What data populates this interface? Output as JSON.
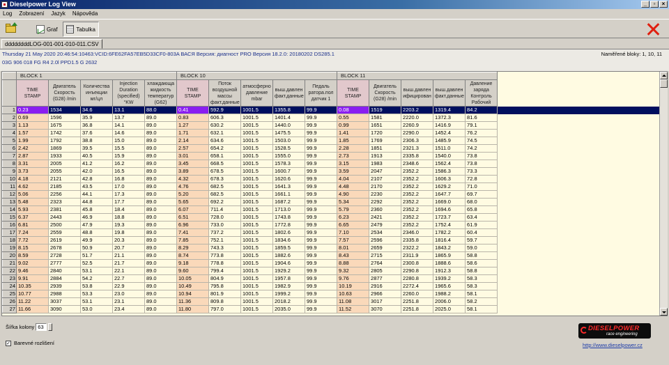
{
  "window": {
    "title": "Dieselpower Log View"
  },
  "menu": [
    "Log",
    "Zobrazení",
    "Jazyk",
    "Nápověda"
  ],
  "toolbar": {
    "graf_label": "Graf",
    "tabulka_label": "Tabulka"
  },
  "file_tab": "ddddddddLOG-001-001-010-011.CSV",
  "info": {
    "line1": "Thursday 21 May 2020 20:46:54:10463:VCID:6FE62FA57EB5D33CF0-803A ВАСЯ Версия: диагност PRO Версия 18.2.0: 20180202 DS285.1",
    "line2": "03G 906 018 FG   R4 2.0l PPD1.5 G    2632",
    "measured_blocks": "Naměřené bloky: 1, 10, 11"
  },
  "blocks": [
    {
      "label": "BLOCK 1",
      "cols": [
        "TIME STAMP",
        "Двигатель Скорость (G28) /min",
        "Количества инъекции мг/цл",
        "Injection Duration (specified) °KW",
        "хлаждающа жидкость температур (G62)"
      ]
    },
    {
      "label": "BLOCK 10",
      "cols": [
        "TIME STAMP",
        "Поток воздушной массы факт.данные",
        "атмосферно давление mbar",
        "выш.давлен факт.данные",
        "Педаль ратора.пол датчик 1"
      ]
    },
    {
      "label": "BLOCK 11",
      "cols": [
        "TIME STAMP",
        "Двигатель Скорость (G28) /min",
        "выш.давлен ифицирован",
        "выш.давлен факт.данные",
        "Давление заряда Контроль Рабочий"
      ]
    }
  ],
  "rows": [
    [
      "0.23",
      "1534",
      "34.6",
      "13.1",
      "88.0",
      "0.41",
      "592.9",
      "1001.5",
      "1355.8",
      "99.9",
      "0.08",
      "1519",
      "2203.2",
      "1319.4",
      "84.2"
    ],
    [
      "0.69",
      "1596",
      "35.9",
      "13.7",
      "89.0",
      "0.83",
      "606.3",
      "1001.5",
      "1401.4",
      "99.9",
      "0.55",
      "1581",
      "2220.0",
      "1372.3",
      "81.6"
    ],
    [
      "1.13",
      "1675",
      "36.8",
      "14.1",
      "89.0",
      "1.27",
      "630.2",
      "1001.5",
      "1440.0",
      "99.9",
      "0.99",
      "1651",
      "2260.9",
      "1416.9",
      "79.1"
    ],
    [
      "1.57",
      "1742",
      "37.6",
      "14.6",
      "89.0",
      "1.71",
      "632.1",
      "1001.5",
      "1475.5",
      "99.9",
      "1.41",
      "1720",
      "2290.0",
      "1452.4",
      "76.2"
    ],
    [
      "1.99",
      "1792",
      "38.8",
      "15.0",
      "89.0",
      "2.14",
      "634.6",
      "1001.5",
      "1503.0",
      "99.9",
      "1.85",
      "1769",
      "2306.3",
      "1485.9",
      "74.5"
    ],
    [
      "2.42",
      "1869",
      "39.5",
      "15.5",
      "89.0",
      "2.57",
      "654.2",
      "1001.5",
      "1528.5",
      "99.9",
      "2.28",
      "1851",
      "2321.3",
      "1511.0",
      "74.2"
    ],
    [
      "2.87",
      "1933",
      "40.5",
      "15.9",
      "89.0",
      "3.01",
      "658.1",
      "1001.5",
      "1555.0",
      "99.9",
      "2.73",
      "1913",
      "2335.8",
      "1540.0",
      "73.8"
    ],
    [
      "3.31",
      "2005",
      "41.2",
      "16.2",
      "89.0",
      "3.45",
      "668.5",
      "1001.5",
      "1578.3",
      "99.9",
      "3.15",
      "1983",
      "2348.6",
      "1562.4",
      "73.8"
    ],
    [
      "3.73",
      "2055",
      "42.0",
      "16.5",
      "89.0",
      "3.89",
      "678.5",
      "1001.5",
      "1600.7",
      "99.9",
      "3.59",
      "2047",
      "2352.2",
      "1586.3",
      "73.3"
    ],
    [
      "4.18",
      "2121",
      "42.8",
      "16.8",
      "89.0",
      "4.32",
      "678.3",
      "1001.5",
      "1620.6",
      "99.9",
      "4.04",
      "2107",
      "2352.2",
      "1606.3",
      "72.8"
    ],
    [
      "4.62",
      "2185",
      "43.5",
      "17.0",
      "89.0",
      "4.76",
      "682.5",
      "1001.5",
      "1641.3",
      "99.9",
      "4.48",
      "2170",
      "2352.2",
      "1629.2",
      "71.0"
    ],
    [
      "5.06",
      "2256",
      "44.1",
      "17.3",
      "89.0",
      "5.20",
      "682.5",
      "1001.5",
      "1661.1",
      "99.9",
      "4.90",
      "2230",
      "2352.2",
      "1647.7",
      "69.7"
    ],
    [
      "5.48",
      "2323",
      "44.8",
      "17.7",
      "89.0",
      "5.65",
      "692.2",
      "1001.5",
      "1687.2",
      "99.9",
      "5.34",
      "2292",
      "2352.2",
      "1669.0",
      "68.0"
    ],
    [
      "5.93",
      "2381",
      "45.8",
      "18.4",
      "89.0",
      "6.07",
      "711.4",
      "1001.5",
      "1713.0",
      "99.9",
      "5.79",
      "2360",
      "2352.2",
      "1694.6",
      "65.8"
    ],
    [
      "6.37",
      "2443",
      "46.9",
      "18.8",
      "89.0",
      "6.51",
      "728.0",
      "1001.5",
      "1743.8",
      "99.9",
      "6.23",
      "2421",
      "2352.2",
      "1723.7",
      "63.4"
    ],
    [
      "6.81",
      "2500",
      "47.9",
      "19.3",
      "89.0",
      "6.96",
      "733.0",
      "1001.5",
      "1772.8",
      "99.9",
      "6.65",
      "2479",
      "2352.2",
      "1752.4",
      "61.9"
    ],
    [
      "7.24",
      "2559",
      "48.8",
      "19.8",
      "89.0",
      "7.41",
      "737.2",
      "1001.5",
      "1802.6",
      "99.9",
      "7.10",
      "2534",
      "2346.0",
      "1782.2",
      "60.4"
    ],
    [
      "7.72",
      "2619",
      "49.9",
      "20.3",
      "89.0",
      "7.85",
      "752.1",
      "1001.5",
      "1834.6",
      "99.9",
      "7.57",
      "2596",
      "2335.8",
      "1816.4",
      "59.7"
    ],
    [
      "8.15",
      "2678",
      "50.9",
      "20.7",
      "89.0",
      "8.29",
      "743.3",
      "1001.5",
      "1859.5",
      "99.9",
      "8.01",
      "2659",
      "2322.2",
      "1843.2",
      "59.0"
    ],
    [
      "8.59",
      "2728",
      "51.7",
      "21.1",
      "89.0",
      "8.74",
      "773.8",
      "1001.5",
      "1882.6",
      "99.9",
      "8.43",
      "2715",
      "2311.9",
      "1865.9",
      "58.8"
    ],
    [
      "9.02",
      "2777",
      "52.5",
      "21.7",
      "89.0",
      "9.18",
      "778.8",
      "1001.5",
      "1904.6",
      "99.9",
      "8.88",
      "2764",
      "2300.8",
      "1888.6",
      "58.6"
    ],
    [
      "9.46",
      "2840",
      "53.1",
      "22.1",
      "89.0",
      "9.60",
      "799.4",
      "1001.5",
      "1929.2",
      "99.9",
      "9.32",
      "2805",
      "2290.8",
      "1912.3",
      "58.8"
    ],
    [
      "9.91",
      "2884",
      "54.2",
      "22.7",
      "89.0",
      "10.05",
      "804.9",
      "1001.5",
      "1957.8",
      "99.9",
      "9.76",
      "2877",
      "2280.8",
      "1939.2",
      "58.3"
    ],
    [
      "10.35",
      "2939",
      "53.8",
      "22.9",
      "89.0",
      "10.49",
      "795.8",
      "1001.5",
      "1982.9",
      "99.9",
      "10.19",
      "2916",
      "2272.4",
      "1965.6",
      "58.3"
    ],
    [
      "10.77",
      "2988",
      "53.3",
      "23.0",
      "89.0",
      "10.94",
      "801.9",
      "1001.5",
      "1999.2",
      "99.9",
      "10.63",
      "2966",
      "2260.0",
      "1988.2",
      "58.1"
    ],
    [
      "11.22",
      "3037",
      "53.1",
      "23.1",
      "89.0",
      "11.36",
      "809.8",
      "1001.5",
      "2018.2",
      "99.9",
      "11.08",
      "3017",
      "2251.8",
      "2006.0",
      "58.2"
    ],
    [
      "11.66",
      "3090",
      "53.0",
      "23.4",
      "89.0",
      "11.80",
      "797.0",
      "1001.5",
      "2035.0",
      "99.9",
      "11.52",
      "3070",
      "2251.8",
      "2025.0",
      "58.1"
    ]
  ],
  "bottom": {
    "column_width_label": "Šířka kolony",
    "column_width_value": "63",
    "colored_label": "Barevné rozlišení",
    "link": "http://www.dieselpower.cz",
    "logo_main": "DIESELPOWER",
    "logo_sub": "race engineering"
  }
}
